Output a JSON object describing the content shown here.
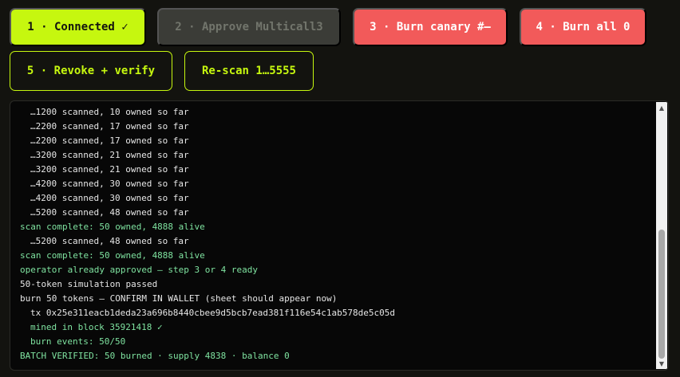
{
  "toolbar": {
    "connected": "1 · Connected ✓",
    "approve": "2 · Approve Multicall3",
    "burn_canary": "3 · Burn canary #—",
    "burn_all": "4 · Burn all 0",
    "revoke": "5 · Revoke + verify",
    "rescan": "Re-scan 1…5555"
  },
  "log": {
    "lines": [
      {
        "text": "…1200 scanned, 10 owned so far",
        "style": "indent"
      },
      {
        "text": "…2200 scanned, 17 owned so far",
        "style": "indent"
      },
      {
        "text": "…2200 scanned, 17 owned so far",
        "style": "indent"
      },
      {
        "text": "…3200 scanned, 21 owned so far",
        "style": "indent"
      },
      {
        "text": "…3200 scanned, 21 owned so far",
        "style": "indent"
      },
      {
        "text": "…4200 scanned, 30 owned so far",
        "style": "indent"
      },
      {
        "text": "…4200 scanned, 30 owned so far",
        "style": "indent"
      },
      {
        "text": "…5200 scanned, 48 owned so far",
        "style": "indent"
      },
      {
        "text": "scan complete: 50 owned, 4888 alive",
        "style": "green"
      },
      {
        "text": "…5200 scanned, 48 owned so far",
        "style": "indent"
      },
      {
        "text": "scan complete: 50 owned, 4888 alive",
        "style": "green"
      },
      {
        "text": "operator already approved — step 3 or 4 ready",
        "style": "green"
      },
      {
        "text": "50-token simulation passed",
        "style": "plain"
      },
      {
        "text": "burn 50 tokens — CONFIRM IN WALLET (sheet should appear now)",
        "style": "plain"
      },
      {
        "text": "tx 0x25e311eacb1deda23a696b8440cbee9d5bcb7ead381f116e54c1ab578de5c05d",
        "style": "indent"
      },
      {
        "text": "mined in block 35921418 ✓",
        "style": "indent green"
      },
      {
        "text": "burn events: 50/50",
        "style": "indent green"
      },
      {
        "text": "BATCH VERIFIED: 50 burned · supply 4838 · balance 0",
        "style": "green"
      }
    ]
  },
  "colors": {
    "background": "#13130f",
    "accent": "#c6f70f",
    "danger": "#f25a5a",
    "success_text": "#7fe3a0"
  },
  "icons": {
    "scroll_up": "scroll-up-arrow-icon",
    "scroll_down": "scroll-down-arrow-icon"
  }
}
